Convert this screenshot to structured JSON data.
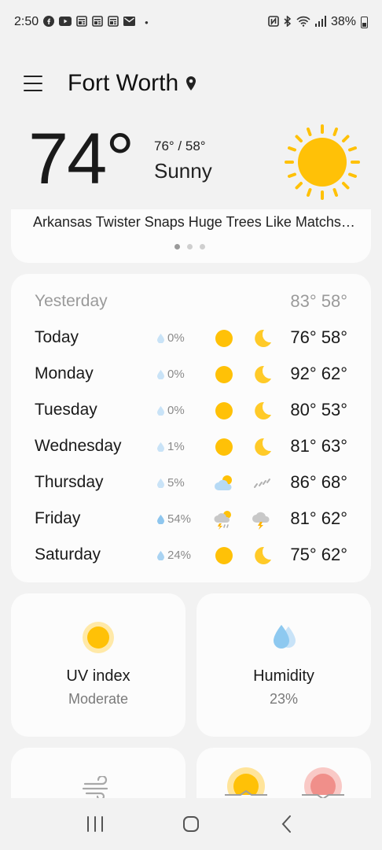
{
  "status_bar": {
    "time": "2:50",
    "notification_icons": [
      "facebook-icon",
      "youtube-icon",
      "news-icon",
      "news-icon",
      "news-icon",
      "mail-icon"
    ],
    "dot": "•",
    "system_icons": [
      "nfc-icon",
      "bluetooth-icon",
      "wifi-icon",
      "signal-icon"
    ],
    "battery": "38%"
  },
  "header": {
    "city": "Fort Worth"
  },
  "current": {
    "temperature": "74°",
    "high_low": "76° / 58°",
    "condition": "Sunny",
    "sun_color": "#FFC107"
  },
  "news": {
    "headline": "Arkansas Twister Snaps Huge Trees Like Matchsticks",
    "page_count": 3,
    "active_index": 0
  },
  "forecast": [
    {
      "day": "Yesterday",
      "precip": "",
      "day_icon": "",
      "night_icon": "",
      "temps": "83° 58°",
      "muted": true
    },
    {
      "day": "Today",
      "precip": "0%",
      "day_icon": "sun-icon",
      "night_icon": "moon-icon",
      "temps": "76° 58°"
    },
    {
      "day": "Monday",
      "precip": "0%",
      "day_icon": "sun-icon",
      "night_icon": "moon-icon",
      "temps": "92° 62°"
    },
    {
      "day": "Tuesday",
      "precip": "0%",
      "day_icon": "sun-icon",
      "night_icon": "moon-icon",
      "temps": "80° 53°"
    },
    {
      "day": "Wednesday",
      "precip": "1%",
      "day_icon": "sun-icon",
      "night_icon": "moon-icon",
      "temps": "81° 63°"
    },
    {
      "day": "Thursday",
      "precip": "5%",
      "day_icon": "partly-cloudy-icon",
      "night_icon": "drizzle-icon",
      "temps": "86° 68°"
    },
    {
      "day": "Friday",
      "precip": "54%",
      "day_icon": "thunderstorm-day-icon",
      "night_icon": "thunderstorm-night-icon",
      "temps": "81° 62°"
    },
    {
      "day": "Saturday",
      "precip": "24%",
      "day_icon": "sun-icon",
      "night_icon": "moon-icon",
      "temps": "75° 62°"
    }
  ],
  "tiles": {
    "uv": {
      "title": "UV index",
      "value": "Moderate"
    },
    "humidity": {
      "title": "Humidity",
      "value": "23%"
    }
  },
  "colors": {
    "sun": "#FFC107",
    "moon": "#FFCA28",
    "drop": "#9ECFF3",
    "card": "#FCFCFC",
    "background": "#F2F2F2"
  }
}
